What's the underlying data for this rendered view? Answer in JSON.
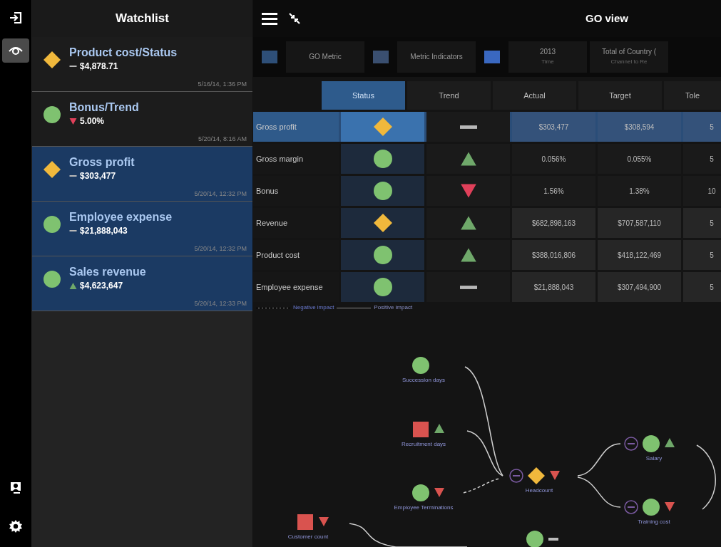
{
  "rail": {
    "items": [
      {
        "selected": false
      },
      {
        "selected": true
      }
    ]
  },
  "watchlist": {
    "title": "Watchlist",
    "items": [
      {
        "title": "Product cost/Status",
        "status": {
          "kind": "average"
        },
        "trend": {
          "kind": "flat"
        },
        "value": "$4,878.71",
        "timestamp": "5/16/14, 1:36 PM",
        "selected": false
      },
      {
        "title": "Bonus/Trend",
        "status": {
          "kind": "good"
        },
        "trend": {
          "kind": "down"
        },
        "value": "5.00%",
        "timestamp": "5/20/14, 8:16 AM",
        "selected": false
      },
      {
        "title": "Gross profit",
        "status": {
          "kind": "average"
        },
        "trend": {
          "kind": "flat"
        },
        "value": "$303,477",
        "timestamp": "5/20/14, 12:32 PM",
        "selected": true
      },
      {
        "title": "Employee expense",
        "status": {
          "kind": "good"
        },
        "trend": {
          "kind": "flat"
        },
        "value": "$21,888,043",
        "timestamp": "5/20/14, 12:32 PM",
        "selected": true
      },
      {
        "title": "Sales revenue",
        "status": {
          "kind": "good"
        },
        "trend": {
          "kind": "up"
        },
        "value": "$4,623,647",
        "timestamp": "5/20/14, 12:33 PM",
        "selected": true
      }
    ]
  },
  "view": {
    "title": "GO view",
    "filters": [
      {
        "label": "GO Metric"
      },
      {
        "label": "Metric Indicators"
      },
      {
        "label": "2013",
        "sub": "Time"
      },
      {
        "label": "Total of Country (",
        "sub": "Channel to Re"
      }
    ],
    "table": {
      "columns": [
        {
          "label": "Status",
          "selected": true
        },
        {
          "label": "Trend",
          "selected": false
        },
        {
          "label": "Actual",
          "selected": false
        },
        {
          "label": "Target",
          "selected": false
        },
        {
          "label": "Tole",
          "selected": false
        }
      ],
      "rows": [
        {
          "label": "Gross profit",
          "status": {
            "kind": "average"
          },
          "trend": {
            "kind": "flat"
          },
          "actual": "$303,477",
          "target": "$308,594",
          "tolerance": "5",
          "selected": true
        },
        {
          "label": "Gross margin",
          "status": {
            "kind": "good"
          },
          "trend": {
            "kind": "up"
          },
          "actual": "0.056%",
          "target": "0.055%",
          "tolerance": "5",
          "selected": false
        },
        {
          "label": "Bonus",
          "status": {
            "kind": "good"
          },
          "trend": {
            "kind": "down"
          },
          "actual": "1.56%",
          "target": "1.38%",
          "tolerance": "10",
          "selected": false
        },
        {
          "label": "Revenue",
          "status": {
            "kind": "average"
          },
          "trend": {
            "kind": "up"
          },
          "actual": "$682,898,163",
          "target": "$707,587,110",
          "tolerance": "5",
          "selected": false
        },
        {
          "label": "Product cost",
          "status": {
            "kind": "good"
          },
          "trend": {
            "kind": "up"
          },
          "actual": "$388,016,806",
          "target": "$418,122,469",
          "tolerance": "5",
          "selected": false
        },
        {
          "label": "Employee expense",
          "status": {
            "kind": "good"
          },
          "trend": {
            "kind": "flat"
          },
          "actual": "$21,888,043",
          "target": "$307,494,900",
          "tolerance": "5",
          "selected": false
        }
      ]
    },
    "legend": [
      {
        "label": "Negative impact",
        "kind": "negative"
      },
      {
        "label": "Positive impact",
        "kind": "positive"
      }
    ],
    "diagram": {
      "nodes": [
        {
          "label": "Succession days",
          "status": {
            "kind": "good"
          }
        },
        {
          "label": "Recruitment days",
          "status": {
            "kind": "poor"
          },
          "trend": {
            "kind": "up"
          }
        },
        {
          "label": "Employee Terminations",
          "status": {
            "kind": "good"
          },
          "trend": {
            "kind": "down"
          }
        },
        {
          "label": "Headcount",
          "status": {
            "kind": "average"
          },
          "trend": {
            "kind": "down"
          },
          "negative": true
        },
        {
          "label": "Salary",
          "status": {
            "kind": "good"
          },
          "trend": {
            "kind": "up"
          },
          "negative": true
        },
        {
          "label": "Training cost",
          "status": {
            "kind": "good"
          },
          "trend": {
            "kind": "down"
          },
          "negative": true
        },
        {
          "label": "Customer count",
          "status": {
            "kind": "poor"
          },
          "trend": {
            "kind": "down"
          }
        },
        {
          "status": {
            "kind": "good"
          },
          "trend": {
            "kind": "flat"
          }
        }
      ]
    }
  }
}
